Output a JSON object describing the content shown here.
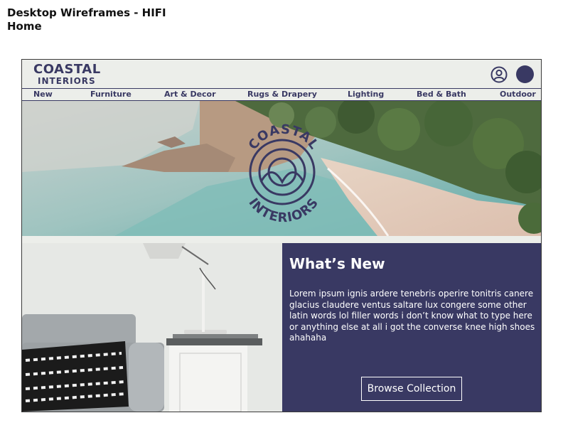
{
  "document": {
    "title": "Desktop Wireframes - HIFI",
    "subtitle": "Home"
  },
  "header": {
    "logo_line1": "COASTAL",
    "logo_line2": "INTERIORS",
    "icons": [
      "user-icon",
      "account-dot-icon"
    ]
  },
  "nav": {
    "items": [
      "New",
      "Furniture",
      "Art & Decor",
      "Rugs & Drapery",
      "Lighting",
      "Bed & Bath",
      "Outdoor"
    ]
  },
  "hero": {
    "emblem_top": "COASTAL",
    "emblem_bottom": "INTERIORS"
  },
  "whats_new": {
    "title": "What’s New",
    "body": "Lorem ipsum ignis ardere tenebris operire tonitris canere glacius claudere ventus saltare lux congere some other latin words lol filler words i don’t know what to type here or anything else at all i got the converse knee high shoes ahahaha",
    "button_label": "Browse Collection"
  },
  "colors": {
    "brand": "#393963",
    "background": "#eceeea"
  }
}
